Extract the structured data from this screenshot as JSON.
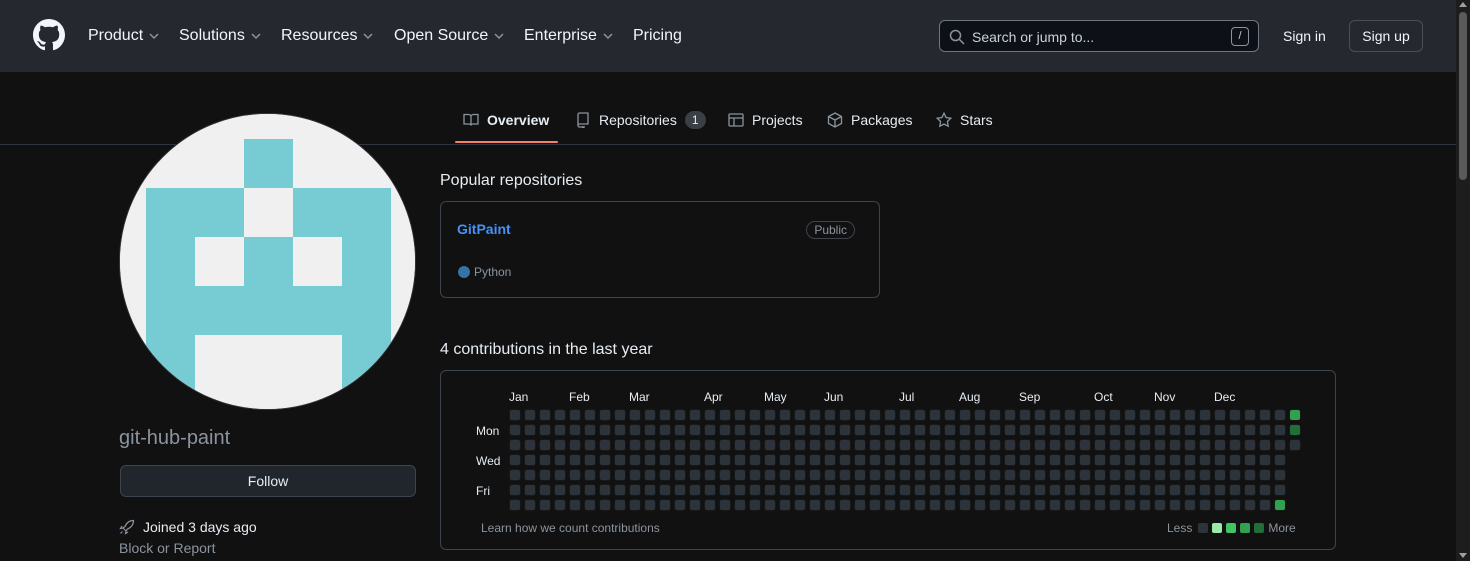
{
  "header": {
    "nav": [
      {
        "label": "Product",
        "has_chevron": true
      },
      {
        "label": "Solutions",
        "has_chevron": true
      },
      {
        "label": "Resources",
        "has_chevron": true
      },
      {
        "label": "Open Source",
        "has_chevron": true
      },
      {
        "label": "Enterprise",
        "has_chevron": true
      },
      {
        "label": "Pricing",
        "has_chevron": false
      }
    ],
    "search_placeholder": "Search or jump to...",
    "search_shortcut": "/",
    "sign_in": "Sign in",
    "sign_up": "Sign up"
  },
  "tabs": [
    {
      "label": "Overview",
      "icon": "book-icon",
      "active": true
    },
    {
      "label": "Repositories",
      "icon": "repo-icon",
      "count": "1"
    },
    {
      "label": "Projects",
      "icon": "table-icon"
    },
    {
      "label": "Packages",
      "icon": "package-icon"
    },
    {
      "label": "Stars",
      "icon": "star-icon"
    }
  ],
  "profile": {
    "username": "git-hub-paint",
    "follow_label": "Follow",
    "joined": "Joined 3 days ago",
    "block_report": "Block or Report",
    "avatar_colors": {
      "bg": "#f0f0f0",
      "fg": "#77ccd4"
    }
  },
  "popular": {
    "title": "Popular repositories",
    "repos": [
      {
        "name": "GitPaint",
        "visibility": "Public",
        "language": "Python",
        "language_color": "#3572a5"
      }
    ]
  },
  "contributions": {
    "title": "4 contributions in the last year",
    "months": [
      "Jan",
      "Feb",
      "Mar",
      "Apr",
      "May",
      "Jun",
      "Jul",
      "Aug",
      "Sep",
      "Oct",
      "Nov",
      "Dec"
    ],
    "days": [
      "Mon",
      "Wed",
      "Fri"
    ],
    "learn_link": "Learn how we count contributions",
    "legend_less": "Less",
    "legend_more": "More",
    "level_colors": [
      "#2d333b",
      "#9be9a8",
      "#40c463",
      "#30a14e",
      "#216e39"
    ],
    "active_cells": [
      {
        "week": 52,
        "day": 0,
        "level": 3
      },
      {
        "week": 52,
        "day": 1,
        "level": 4
      },
      {
        "week": 51,
        "day": 6,
        "level": 3
      }
    ]
  }
}
